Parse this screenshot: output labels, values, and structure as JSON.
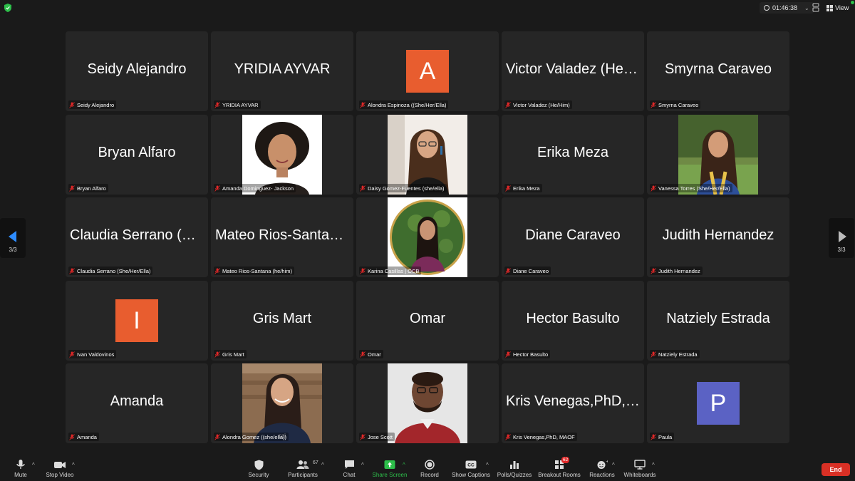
{
  "topbar": {
    "timer": "01:46:38",
    "view_label": "View"
  },
  "colors": {
    "tile_bg": "#262626",
    "avatar_orange": "#e85d2f",
    "avatar_purple": "#5b62c4",
    "share_green": "#2dbe4a",
    "end_red": "#d93025"
  },
  "pagination": {
    "left_label": "3/3",
    "right_label": "3/3"
  },
  "tiles": [
    {
      "type": "text",
      "display": "Seidy Alejandro",
      "label": "Seidy Alejandro"
    },
    {
      "type": "text",
      "display": "YRIDIA AYVAR",
      "label": "YRIDIA AYVAR"
    },
    {
      "type": "initial",
      "display": "A",
      "color": "#e85d2f",
      "label": "Alondra Espinoza ((She/Her/Ella)"
    },
    {
      "type": "text",
      "display": "Victor Valadez (He/Him)",
      "label": "Victor Valadez (He/Him)"
    },
    {
      "type": "text",
      "display": "Smyrna Caraveo",
      "label": "Smyrna Caraveo"
    },
    {
      "type": "text",
      "display": "Bryan Alfaro",
      "label": "Bryan Alfaro"
    },
    {
      "type": "photo",
      "photo": "woman-curly-hair-photo",
      "label": "Amanda Dominguez- Jackson"
    },
    {
      "type": "photo",
      "photo": "woman-glasses-photo",
      "label": "Daisy Gomez-Fuentes (she/ella)"
    },
    {
      "type": "text",
      "display": "Erika Meza",
      "label": "Erika Meza"
    },
    {
      "type": "photo",
      "photo": "woman-graduation-photo",
      "label": "Vanessa Torres (She/Her/Ella)"
    },
    {
      "type": "text",
      "display": "Claudia Serrano (She/Her/Ella)",
      "label": "Claudia Serrano (She/Her/Ella)"
    },
    {
      "type": "text",
      "display": "Mateo Rios-Santana (he/him)",
      "label": "Mateo Rios-Santana (he/him)"
    },
    {
      "type": "photo",
      "photo": "woman-circle-frame-photo",
      "label": "Karina Casillas | OCB"
    },
    {
      "type": "text",
      "display": "Diane Caraveo",
      "label": "Diane Caraveo"
    },
    {
      "type": "text",
      "display": "Judith Hernandez",
      "label": "Judith Hernandez"
    },
    {
      "type": "initial",
      "display": "I",
      "color": "#e85d2f",
      "label": "Ivan Valdovinos"
    },
    {
      "type": "text",
      "display": "Gris Mart",
      "label": "Gris Mart"
    },
    {
      "type": "text",
      "display": "Omar",
      "label": "Omar"
    },
    {
      "type": "text",
      "display": "Hector Basulto",
      "label": "Hector Basulto"
    },
    {
      "type": "text",
      "display": "Natziely Estrada",
      "label": "Natziely Estrada"
    },
    {
      "type": "text",
      "display": "Amanda",
      "label": "Amanda"
    },
    {
      "type": "photo",
      "photo": "woman-sweatshirt-photo",
      "label": "Alondra Gomez ((she/ella))"
    },
    {
      "type": "photo",
      "photo": "man-red-sweater-photo",
      "label": "Jose Scott"
    },
    {
      "type": "text",
      "display": "Kris Venegas,PhD, MAOF",
      "label": "Kris Venegas,PhD, MAOF"
    },
    {
      "type": "initial",
      "display": "P",
      "color": "#5b62c4",
      "label": "Paula"
    }
  ],
  "toolbar": {
    "mute": "Mute",
    "stop_video": "Stop Video",
    "security": "Security",
    "participants": "Participants",
    "participants_count": "67",
    "chat": "Chat",
    "share_screen": "Share Screen",
    "record": "Record",
    "show_captions": "Show Captions",
    "polls": "Polls/Quizzes",
    "breakout": "Breakout Rooms",
    "breakout_badge": "62",
    "reactions": "Reactions",
    "whiteboards": "Whiteboards",
    "end": "End"
  }
}
